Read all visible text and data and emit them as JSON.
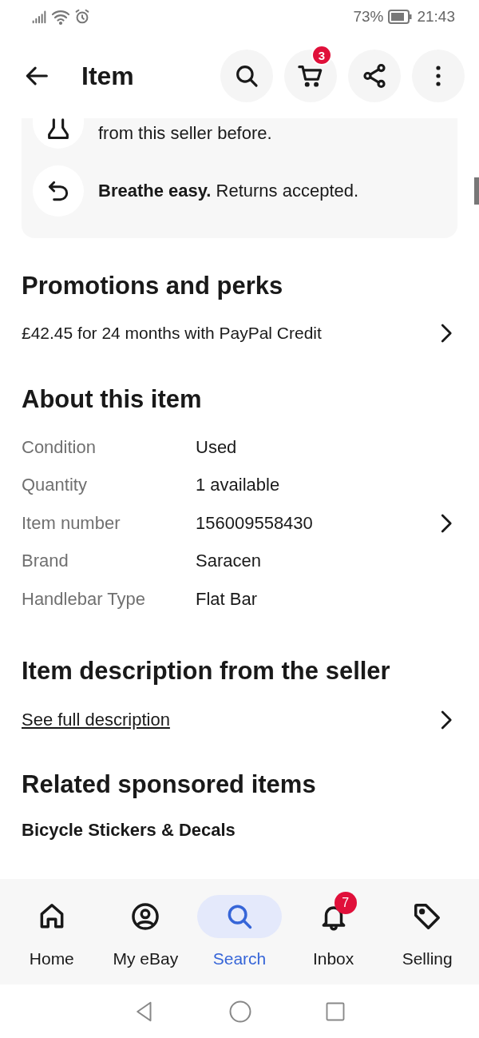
{
  "status_bar": {
    "battery": "73%",
    "time": "21:43"
  },
  "header": {
    "title": "Item",
    "cart_badge": "3"
  },
  "assurances": [
    {
      "kind": "seller",
      "text": "from this seller before."
    },
    {
      "kind": "returns",
      "text": "**Breathe easy.** Returns accepted."
    }
  ],
  "promotions": {
    "title": "Promotions and perks",
    "offer": "£42.45 for 24 months with PayPal Credit"
  },
  "about": {
    "title": "About this item",
    "rows": [
      {
        "label": "Condition",
        "value": "Used",
        "chevron": false
      },
      {
        "label": "Quantity",
        "value": "1 available",
        "chevron": false
      },
      {
        "label": "Item number",
        "value": "156009558430",
        "chevron": true
      },
      {
        "label": "Brand",
        "value": "Saracen",
        "chevron": false
      },
      {
        "label": "Handlebar Type",
        "value": "Flat Bar",
        "chevron": false
      }
    ]
  },
  "description": {
    "title": "Item description from the seller",
    "link": "See full description"
  },
  "related": {
    "title": "Related sponsored items",
    "subtitle": "Bicycle Stickers & Decals"
  },
  "nav": [
    {
      "kind": "home",
      "label": "Home",
      "selected": false
    },
    {
      "kind": "account",
      "label": "My eBay",
      "selected": false
    },
    {
      "kind": "search",
      "label": "Search",
      "selected": true
    },
    {
      "kind": "inbox",
      "label": "Inbox",
      "selected": false,
      "badge": "7"
    },
    {
      "kind": "selling",
      "label": "Selling",
      "selected": false
    }
  ]
}
